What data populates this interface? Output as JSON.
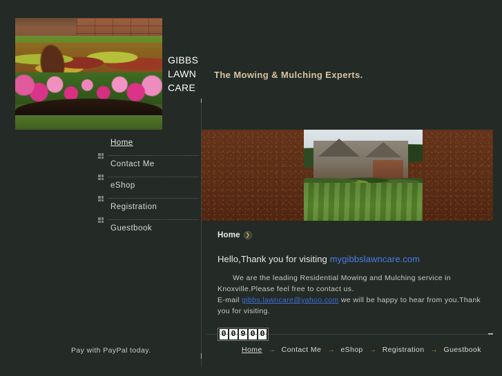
{
  "site": {
    "background_color": "#242a26",
    "accent_color": "#d08a3c",
    "link_color": "#4a7ce8"
  },
  "header": {
    "logo_line1": "GIBBS",
    "logo_line2": "LAWN",
    "logo_line3": "CARE",
    "logo_photo_alt": "flower-bed-photo",
    "tagline": "The Mowing & Mulching Experts."
  },
  "sidebar": {
    "items": [
      {
        "label": "Home",
        "active": true
      },
      {
        "label": "Contact Me",
        "active": false
      },
      {
        "label": "eShop",
        "active": false
      },
      {
        "label": "Registration",
        "active": false
      },
      {
        "label": "Guestbook",
        "active": false
      }
    ]
  },
  "banner": {
    "photo_alt": "house-with-striped-lawn-photo",
    "background_color": "#5c2e16"
  },
  "main": {
    "breadcrumb": "Home",
    "breadcrumb_arrow_glyph": "❯",
    "greeting_prefix": "Hello,Thank you for visiting ",
    "greeting_link": "mygibbslawncare.com",
    "paragraph_line1": "We are the leading Residential Mowing and Mulching service in Knoxville.Please feel free to contact us.",
    "paragraph_email_prefix": "E-mail ",
    "paragraph_email": "gibbs.lawncare@yahoo.com",
    "paragraph_line2_tail": " we will be happy to hear from you.Thank you for visiting.",
    "visitor_counter": "00900"
  },
  "footer": {
    "paypal_text": "Pay with PayPal today.",
    "separator_glyph": "→",
    "nav": [
      {
        "label": "Home",
        "active": true
      },
      {
        "label": "Contact Me",
        "active": false
      },
      {
        "label": "eShop",
        "active": false
      },
      {
        "label": "Registration",
        "active": false
      },
      {
        "label": "Guestbook",
        "active": false
      }
    ]
  }
}
